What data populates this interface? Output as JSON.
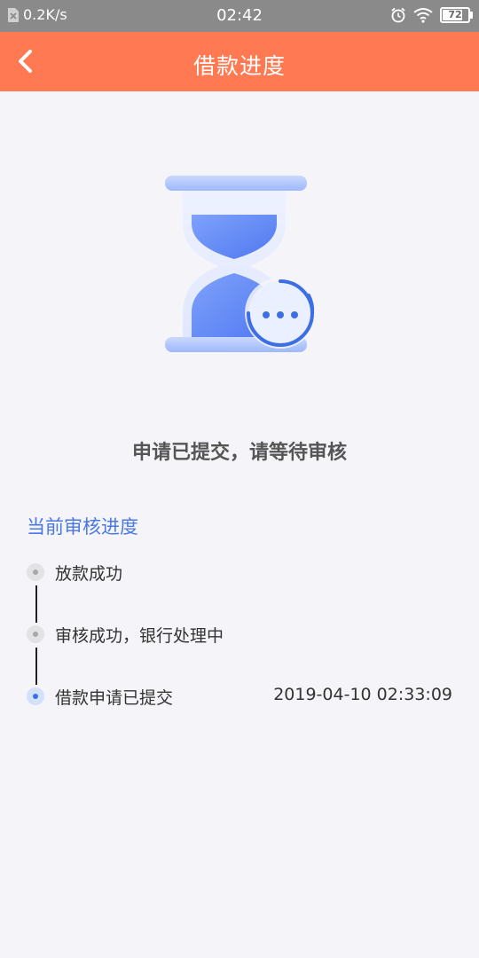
{
  "status_bar": {
    "net_speed": "0.2K/s",
    "time": "02:42",
    "battery": "72"
  },
  "nav": {
    "title": "借款进度"
  },
  "main": {
    "message": "申请已提交，请等待审核",
    "progress_title": "当前审核进度",
    "steps": [
      {
        "label": "放款成功",
        "time": ""
      },
      {
        "label": "审核成功，银行处理中",
        "time": ""
      },
      {
        "label": "借款申请已提交",
        "time": "2019-04-10 02:33:09"
      }
    ]
  },
  "colors": {
    "nav_bg": "#ff7a52",
    "accent_blue": "#4a78e6",
    "page_bg": "#f4f4f9"
  }
}
